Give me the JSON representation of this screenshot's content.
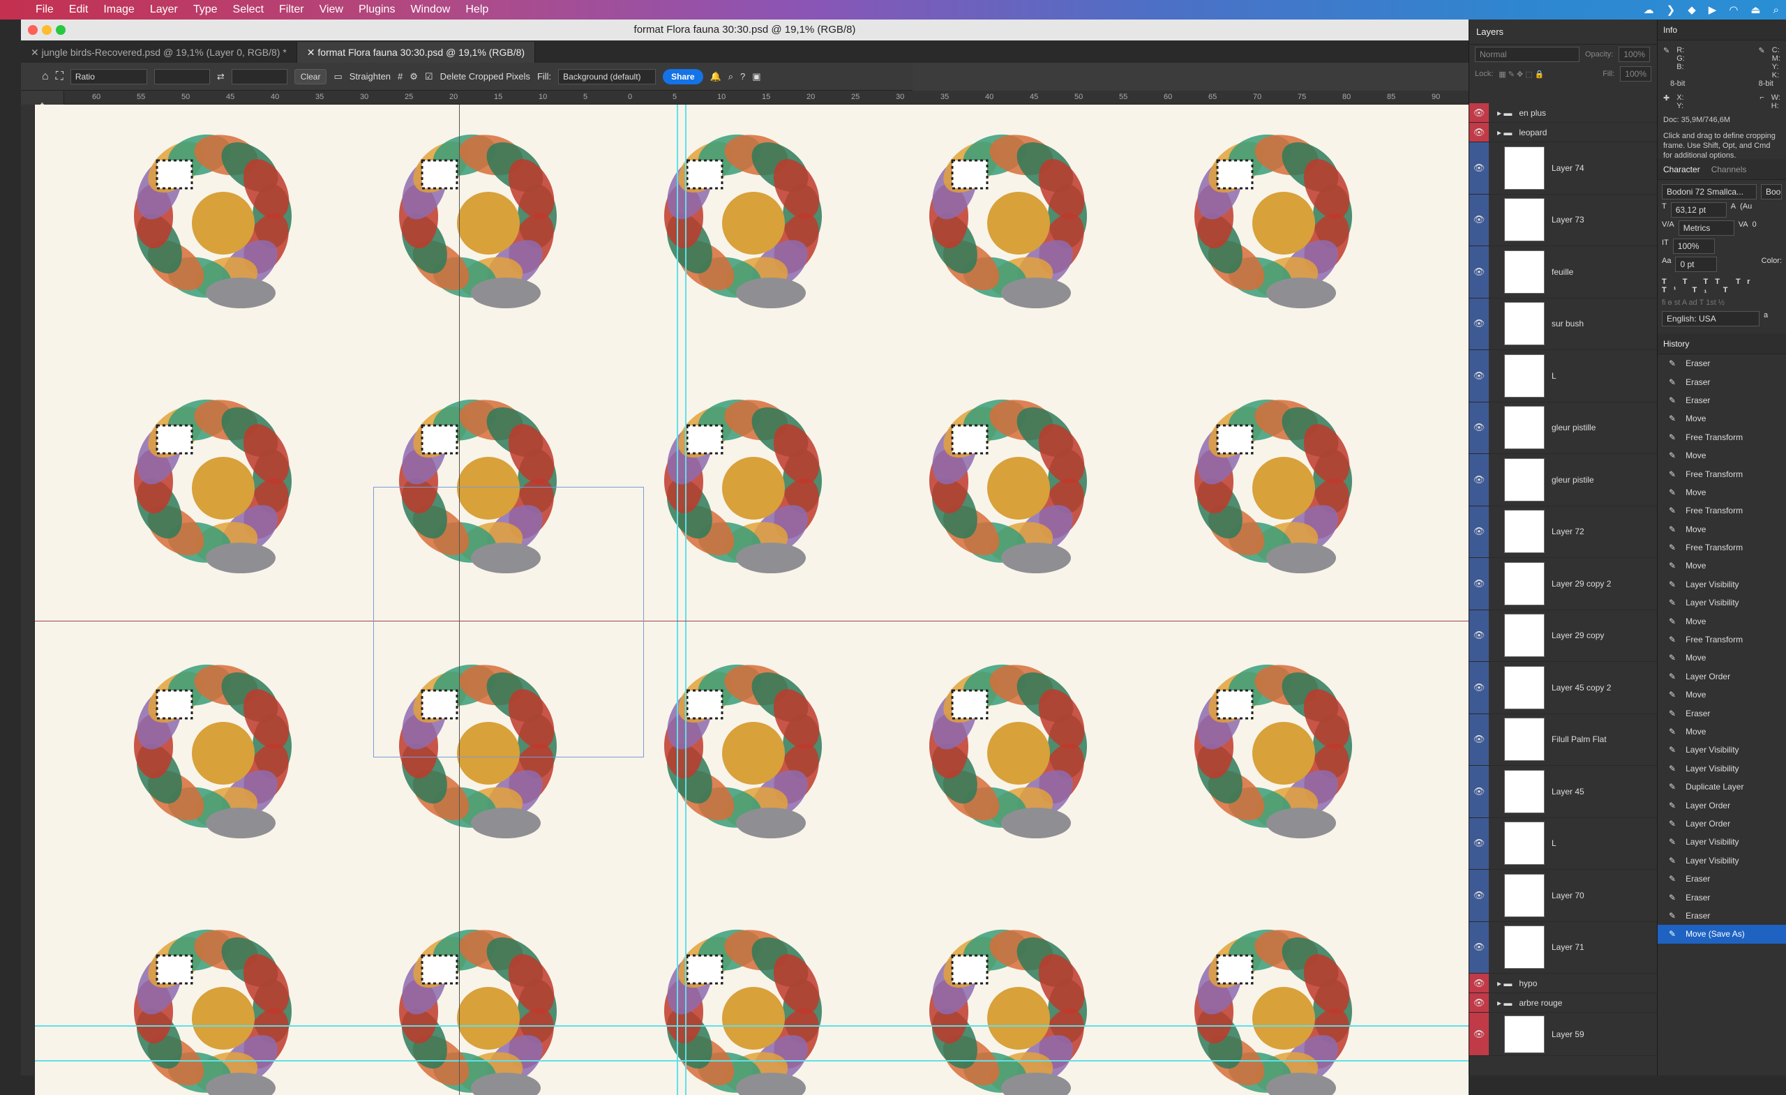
{
  "menubar": {
    "items": [
      "File",
      "Edit",
      "Image",
      "Layer",
      "Type",
      "Select",
      "Filter",
      "View",
      "Plugins",
      "Window",
      "Help"
    ]
  },
  "window": {
    "title": "format Flora fauna 30:30.psd @ 19,1% (RGB/8)",
    "tabs": [
      {
        "label": "jungle birds-Recovered.psd @ 19,1% (Layer 0, RGB/8) *"
      },
      {
        "label": "format Flora fauna 30:30.psd @ 19,1% (RGB/8)"
      }
    ]
  },
  "options": {
    "ratio": "Ratio",
    "clear": "Clear",
    "straighten": "Straighten",
    "delete_cropped": "Delete Cropped Pixels",
    "fill_label": "Fill:",
    "fill_value": "Background (default)",
    "share": "Share"
  },
  "ruler": {
    "top": [
      "60",
      "55",
      "50",
      "45",
      "40",
      "35",
      "30",
      "25",
      "20",
      "15",
      "10",
      "5",
      "0",
      "5",
      "10",
      "15",
      "20",
      "25",
      "30",
      "35",
      "40",
      "45",
      "50",
      "55",
      "60",
      "65",
      "70",
      "75",
      "80",
      "85",
      "90"
    ]
  },
  "layers": {
    "title": "Layers",
    "blend": "Normal",
    "opacity_label": "Opacity:",
    "opacity": "100%",
    "fill_label": "Fill:",
    "fill": "100%",
    "lock_label": "Lock:",
    "groups": [
      "en plus",
      "leopard"
    ],
    "items": [
      {
        "name": "Layer 74"
      },
      {
        "name": "Layer 73"
      },
      {
        "name": "feuille"
      },
      {
        "name": "sur bush"
      },
      {
        "name": "L"
      },
      {
        "name": "gleur pistille"
      },
      {
        "name": "gleur pistile"
      },
      {
        "name": "Layer 72"
      },
      {
        "name": "Layer 29 copy 2"
      },
      {
        "name": "Layer 29 copy"
      },
      {
        "name": "Layer 45 copy 2"
      },
      {
        "name": "Filull Palm Flat"
      },
      {
        "name": "Layer 45"
      },
      {
        "name": "L"
      },
      {
        "name": "Layer 70"
      },
      {
        "name": "Layer 71"
      }
    ],
    "groups_bottom": [
      "hypo",
      "arbre rouge"
    ],
    "last_layer": "Layer 59"
  },
  "info": {
    "title": "Info",
    "rgb": "R:\nG:\nB:",
    "cmyk": "C:\nM:\nY:\nK:",
    "bit1": "8-bit",
    "bit2": "8-bit",
    "xy": "X:\nY:",
    "wh": "W:\nH:",
    "doc": "Doc: 35,9M/746,6M",
    "hint": "Click and drag to define cropping frame. Use Shift, Opt, and Cmd for additional options."
  },
  "character": {
    "tab1": "Character",
    "tab2": "Channels",
    "font": "Bodoni 72 Smallca...",
    "style": "Boo",
    "size": "63,12 pt",
    "leading": "(Au",
    "kerning": "Metrics",
    "tracking": "0",
    "scale": "100%",
    "baseline": "0 pt",
    "color_label": "Color:",
    "language": "English: USA",
    "aa": "a"
  },
  "history": {
    "title": "History",
    "items": [
      "Eraser",
      "Eraser",
      "Eraser",
      "Move",
      "Free Transform",
      "Move",
      "Free Transform",
      "Move",
      "Free Transform",
      "Move",
      "Free Transform",
      "Move",
      "Layer Visibility",
      "Layer Visibility",
      "Move",
      "Free Transform",
      "Move",
      "Layer Order",
      "Move",
      "Eraser",
      "Move",
      "Layer Visibility",
      "Layer Visibility",
      "Duplicate Layer",
      "Layer Order",
      "Layer Order",
      "Layer Visibility",
      "Layer Visibility",
      "Eraser",
      "Eraser",
      "Eraser",
      "Move (Save As)"
    ]
  },
  "colors": {
    "accent": "#1473e6",
    "guide": "#60e0e8",
    "canvas": "#f8f4ea",
    "foreground": "#8c2b55"
  }
}
